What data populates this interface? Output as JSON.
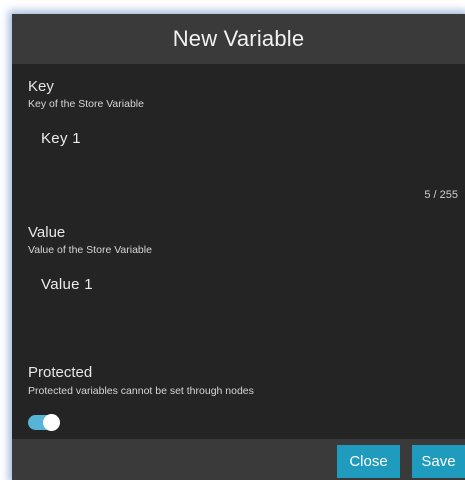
{
  "dialog": {
    "title": "New Variable"
  },
  "key": {
    "label": "Key",
    "hint": "Key of the Store Variable",
    "value": "Key 1",
    "counter": "5 / 255"
  },
  "value": {
    "label": "Value",
    "hint": "Value of the Store Variable",
    "value": "Value 1"
  },
  "protected": {
    "label": "Protected",
    "hint": "Protected variables cannot be set through nodes",
    "enabled": true
  },
  "footer": {
    "close_label": "Close",
    "save_label": "Save"
  },
  "colors": {
    "accent": "#1f9bbd",
    "toggle_on": "#58b4d6",
    "dialog_bg": "#242424",
    "header_bg": "#3a3a3a"
  }
}
